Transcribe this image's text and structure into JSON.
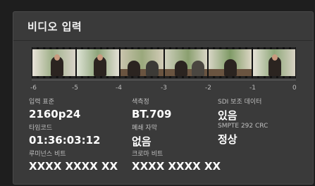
{
  "panel": {
    "title": "비디오 입력"
  },
  "timeline": {
    "ticks": [
      "-6",
      "-5",
      "-4",
      "-3",
      "-2",
      "-1",
      "0"
    ]
  },
  "fields": {
    "input_standard": {
      "label": "입력 표준",
      "value": "2160p24"
    },
    "colorimetry": {
      "label": "색측정",
      "value": "BT.709"
    },
    "sdi_aux": {
      "label": "SDI 보조 데이터",
      "value": "있음"
    },
    "timecode": {
      "label": "타임코드",
      "value": "01:36:03:12"
    },
    "closed_captions": {
      "label": "폐쇄 자막",
      "value": "없음"
    },
    "smpte_crc": {
      "label": "SMPTE 292 CRC",
      "value": "정상"
    },
    "luminance_bits": {
      "label": "루미넌스 비트",
      "value": "XXXX XXXX XX"
    },
    "chroma_bits": {
      "label": "크로마 비트",
      "value": "XXXX XXXX XX"
    }
  },
  "colors": {
    "panel_bg": "#3a3a3a",
    "page_bg": "#1e1e1e"
  }
}
